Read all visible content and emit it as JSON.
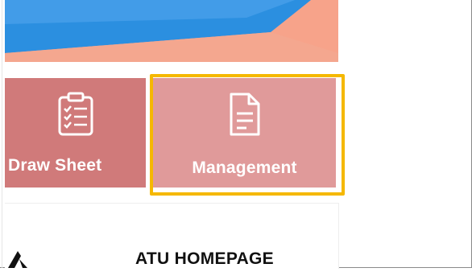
{
  "tiles": {
    "draw_sheet_label": "Draw Sheet",
    "management_label": "Management",
    "draw_sheet_icon": "clipboard-checklist-icon",
    "management_icon": "document-icon"
  },
  "footer": {
    "homepage_label": "ATU HOMEPAGE",
    "logo_icon": "atu-logo-icon"
  },
  "colors": {
    "draw_tile_bg": "#d07a7a",
    "management_tile_bg": "#e09a9a",
    "highlight_border": "#f5b800",
    "banner_blue": "#2b8fe0",
    "banner_salmon": "#f7a38a"
  }
}
